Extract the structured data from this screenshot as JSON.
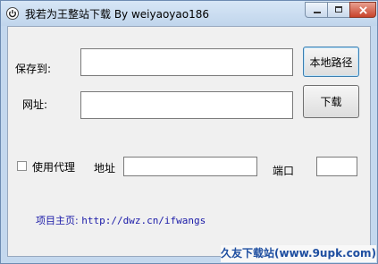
{
  "window": {
    "title": "我若为王整站下载   By weiyaoyao186"
  },
  "form": {
    "save_label": "保存到:",
    "save_value": "",
    "browse_button": "本地路径",
    "url_label": "网址:",
    "url_value": "",
    "download_button": "下载",
    "proxy_label": "使用代理",
    "proxy_checked": false,
    "address_label": "地址",
    "address_value": "",
    "port_label": "端口",
    "port_value": ""
  },
  "footer": {
    "homepage_label": "项目主页:",
    "homepage_url": "http://dwz.cn/ifwangs"
  },
  "watermark": {
    "text": "久友下载站(www.9upk.com)"
  },
  "icons": {
    "app": "power-icon",
    "minimize": "minimize-icon",
    "maximize": "maximize-icon",
    "close": "close-icon"
  }
}
